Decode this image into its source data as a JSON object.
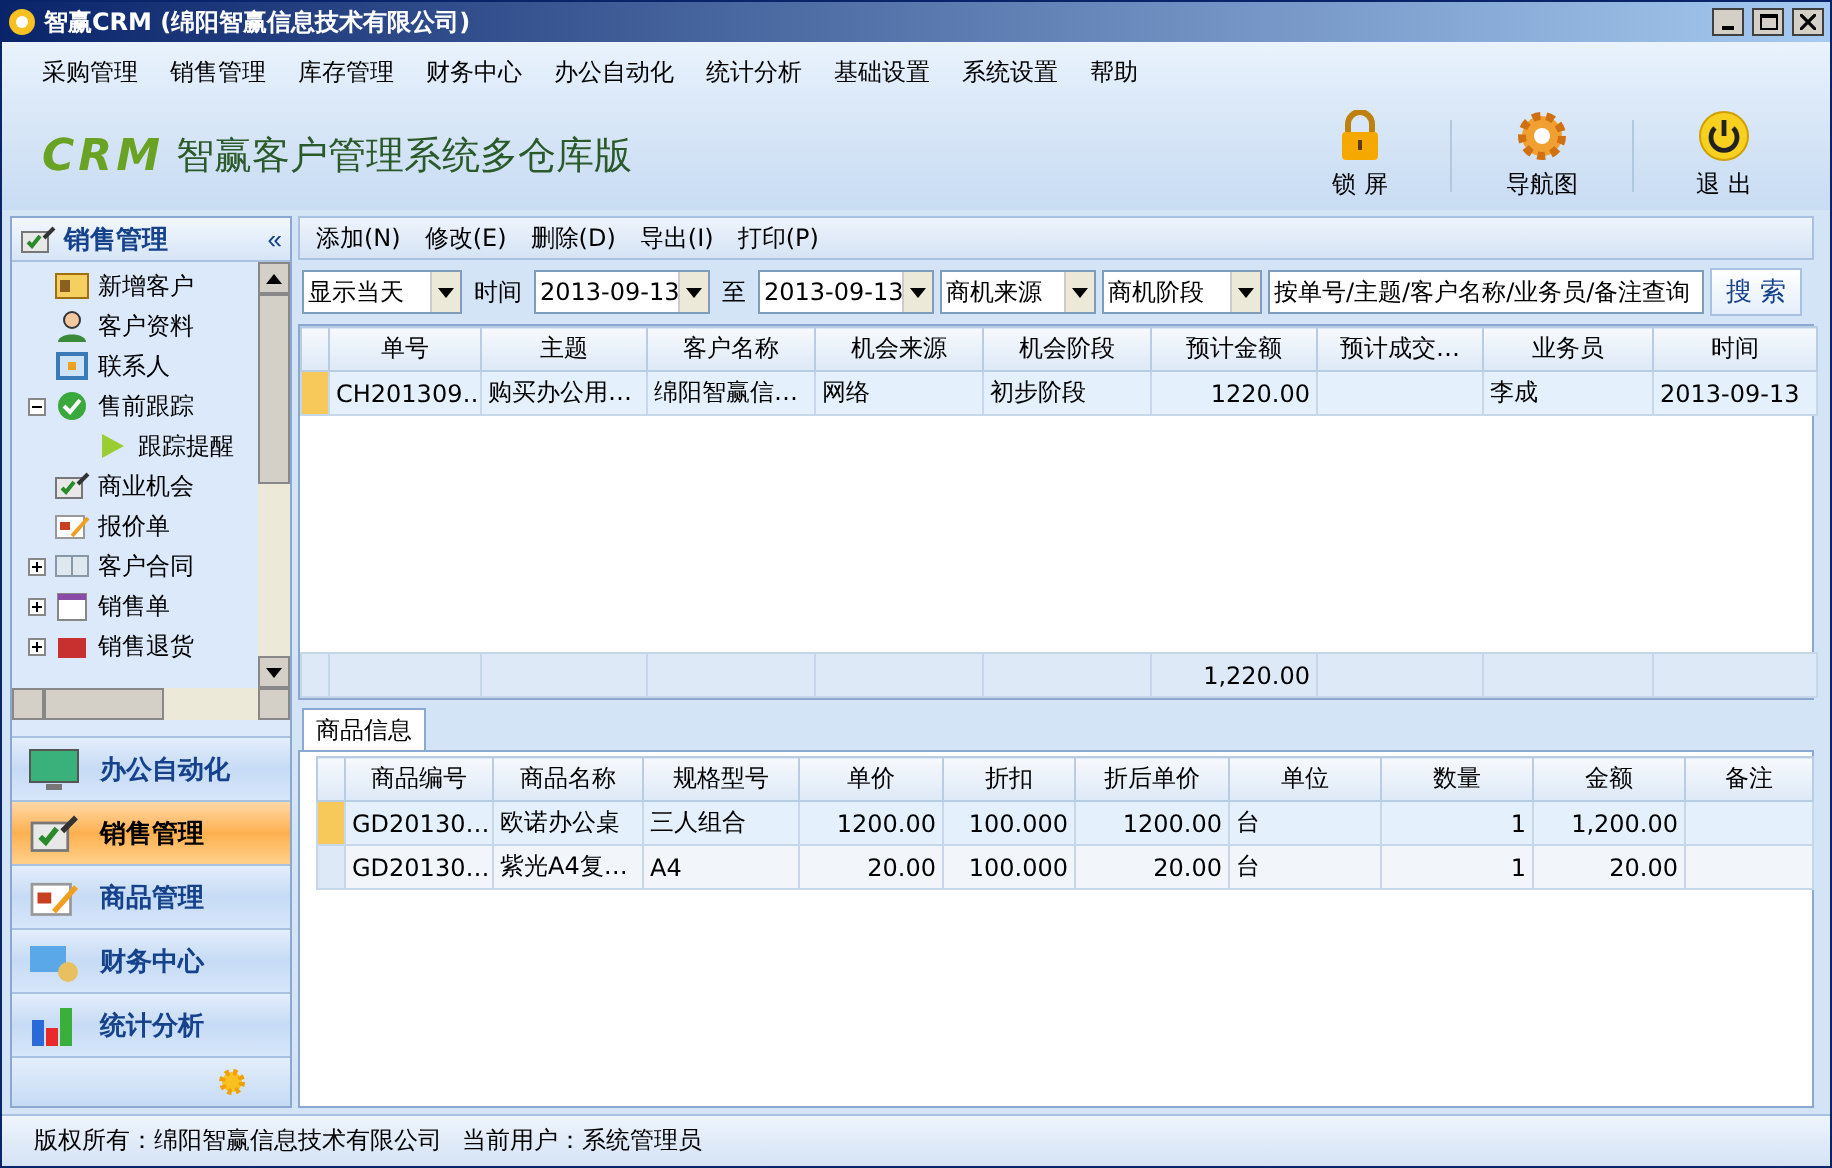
{
  "window": {
    "title": "智赢CRM (绵阳智赢信息技术有限公司)"
  },
  "menu": [
    "采购管理",
    "销售管理",
    "库存管理",
    "财务中心",
    "办公自动化",
    "统计分析",
    "基础设置",
    "系统设置",
    "帮助"
  ],
  "banner": {
    "logo": "CRM",
    "title": "智赢客户管理系统多仓库版",
    "actions": [
      {
        "kind": "lock",
        "label": "锁 屏"
      },
      {
        "kind": "gear",
        "label": "导航图"
      },
      {
        "kind": "power",
        "label": "退 出"
      }
    ]
  },
  "sidebar": {
    "title": "销售管理",
    "collapse": "«",
    "tree": [
      {
        "label": "新增客户",
        "kind": "card"
      },
      {
        "label": "客户资料",
        "kind": "person"
      },
      {
        "label": "联系人",
        "kind": "contact"
      },
      {
        "label": "售前跟踪",
        "kind": "check",
        "expanded": true,
        "children": [
          {
            "label": "跟踪提醒",
            "kind": "play"
          }
        ]
      },
      {
        "label": "商业机会",
        "kind": "pen"
      },
      {
        "label": "报价单",
        "kind": "quote"
      },
      {
        "label": "客户合同",
        "kind": "book",
        "expanded": false
      },
      {
        "label": "销售单",
        "kind": "calendar",
        "expanded": false
      },
      {
        "label": "销售退货",
        "kind": "return",
        "expanded": false
      }
    ],
    "nav": [
      {
        "label": "办公自动化",
        "kind": "monitor",
        "selected": false
      },
      {
        "label": "销售管理",
        "kind": "pen",
        "selected": true
      },
      {
        "label": "商品管理",
        "kind": "quote",
        "selected": false
      },
      {
        "label": "财务中心",
        "kind": "money",
        "selected": false
      },
      {
        "label": "统计分析",
        "kind": "chart",
        "selected": false
      }
    ]
  },
  "toolbar": [
    "添加(N)",
    "修改(E)",
    "删除(D)",
    "导出(I)",
    "打印(P)"
  ],
  "filters": {
    "range": "显示当天",
    "time_label": "时间",
    "from": "2013-09-13",
    "to_label": "至",
    "to": "2013-09-13",
    "source": "商机来源",
    "stage": "商机阶段",
    "search_placeholder": "按单号/主题/客户名称/业务员/备注查询",
    "search_button": "搜 索"
  },
  "table": {
    "columns": [
      "单号",
      "主题",
      "客户名称",
      "机会来源",
      "机会阶段",
      "预计金额",
      "预计成交…",
      "业务员",
      "时间"
    ],
    "rows": [
      {
        "selected": true,
        "cells": [
          "CH201309…",
          "购买办公用…",
          "绵阳智赢信…",
          "网络",
          "初步阶段",
          "1220.00",
          "",
          "李成",
          "2013-09-13"
        ]
      }
    ],
    "total_amount": "1,220.00"
  },
  "detail": {
    "tab": "商品信息",
    "columns": [
      "商品编号",
      "商品名称",
      "规格型号",
      "单价",
      "折扣",
      "折后单价",
      "单位",
      "数量",
      "金额",
      "备注"
    ],
    "rows": [
      {
        "selected": true,
        "cells": [
          "GD20130…",
          "欧诺办公桌",
          "三人组合",
          "1200.00",
          "100.000",
          "1200.00",
          "台",
          "1",
          "1,200.00",
          ""
        ]
      },
      {
        "selected": false,
        "cells": [
          "GD20130…",
          "紫光A4复…",
          "A4",
          "20.00",
          "100.000",
          "20.00",
          "台",
          "1",
          "20.00",
          ""
        ]
      }
    ]
  },
  "status_bar": {
    "copyright": "版权所有：绵阳智赢信息技术有限公司",
    "user": "当前用户：系统管理员"
  }
}
